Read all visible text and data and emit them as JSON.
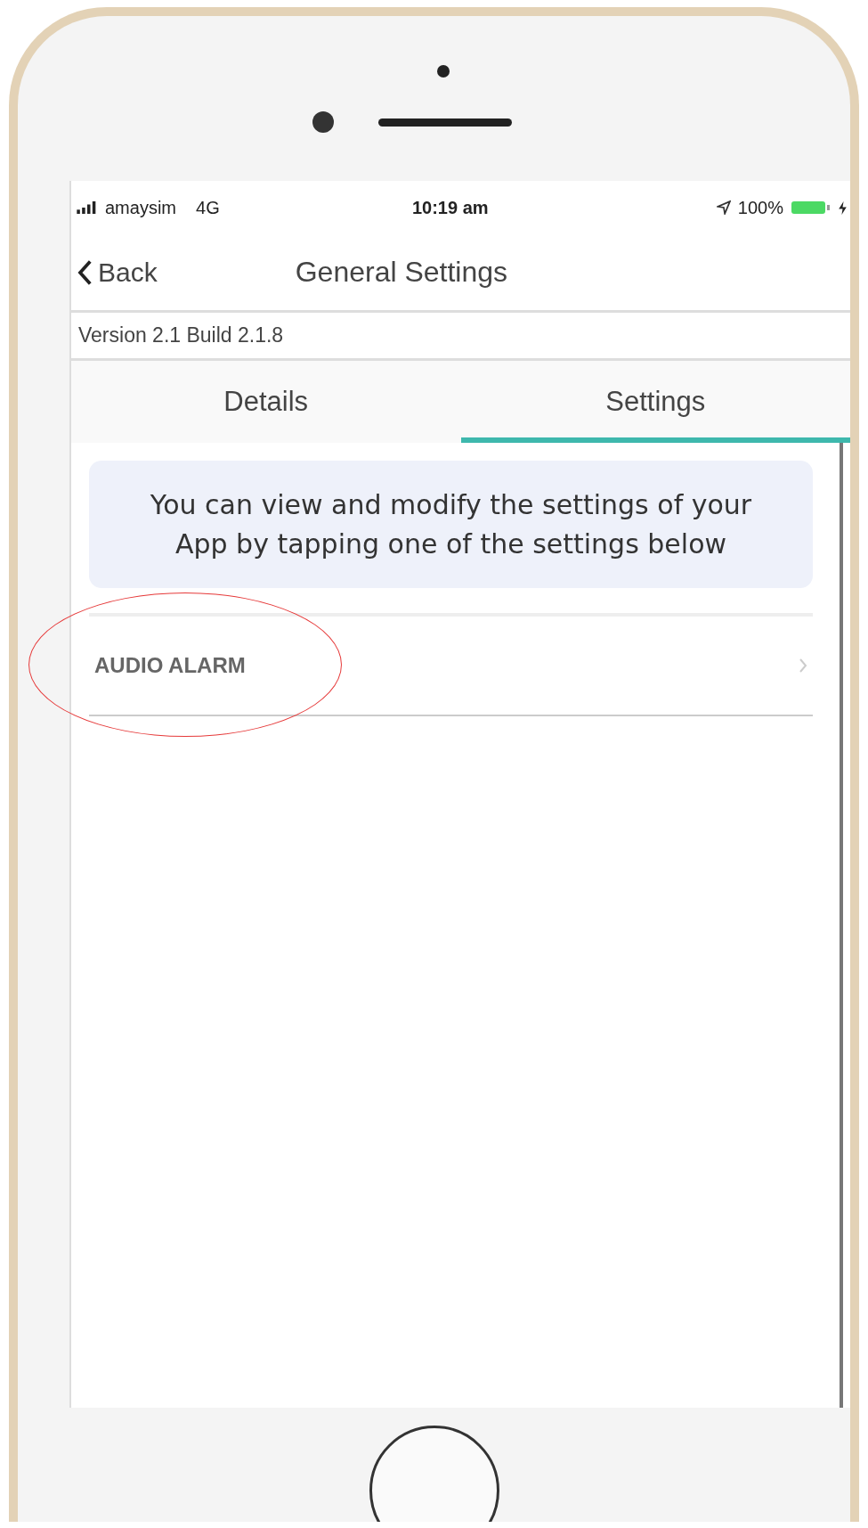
{
  "status_bar": {
    "carrier": "amaysim",
    "network": "4G",
    "time": "10:19 am",
    "battery": "100%"
  },
  "nav": {
    "back": "Back",
    "title": "General Settings"
  },
  "version": "Version 2.1 Build 2.1.8",
  "tabs": [
    {
      "label": "Details",
      "selected": false
    },
    {
      "label": "Settings",
      "selected": true
    }
  ],
  "info": "You can view and modify the settings of your App by tapping one of the settings below",
  "settings": [
    {
      "label": "AUDIO ALARM"
    }
  ]
}
